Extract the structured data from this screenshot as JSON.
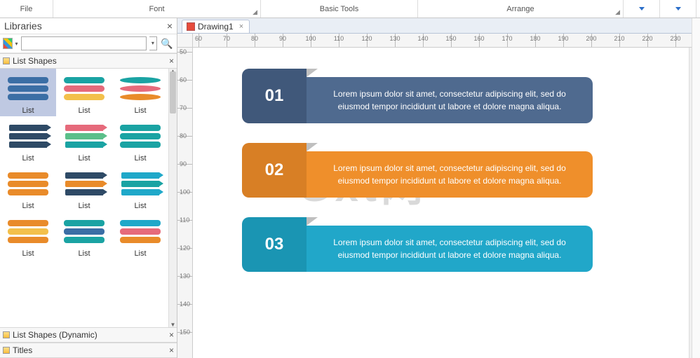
{
  "ribbon": {
    "file": "File",
    "font": "Font",
    "basic": "Basic Tools",
    "arrange": "Arrange"
  },
  "libraries": {
    "title": "Libraries",
    "categories": {
      "list_shapes": "List Shapes",
      "list_shapes_dynamic": "List Shapes (Dynamic)",
      "titles": "Titles"
    },
    "item_label": "List"
  },
  "document": {
    "tab_name": "Drawing1"
  },
  "ruler_h": [
    60,
    70,
    80,
    90,
    100,
    110,
    120,
    130,
    140,
    150,
    160,
    170,
    180,
    190,
    200,
    210,
    220,
    230
  ],
  "ruler_v": [
    50,
    60,
    70,
    80,
    90,
    100,
    110,
    120,
    130,
    140,
    150
  ],
  "canvas_items": [
    {
      "num": "01",
      "text": "Lorem ipsum dolor sit amet, consectetur adipiscing elit, sed do eiusmod tempor incididunt ut labore et dolore magna aliqua."
    },
    {
      "num": "02",
      "text": "Lorem ipsum dolor sit amet, consectetur adipiscing elit, sed do eiusmod tempor incididunt ut labore et dolore magna aliqua."
    },
    {
      "num": "03",
      "text": "Lorem ipsum dolor sit amet, consectetur adipiscing elit, sed do eiusmod tempor incididunt ut labore et dolore magna aliqua."
    }
  ],
  "watermark": "Gxt网"
}
